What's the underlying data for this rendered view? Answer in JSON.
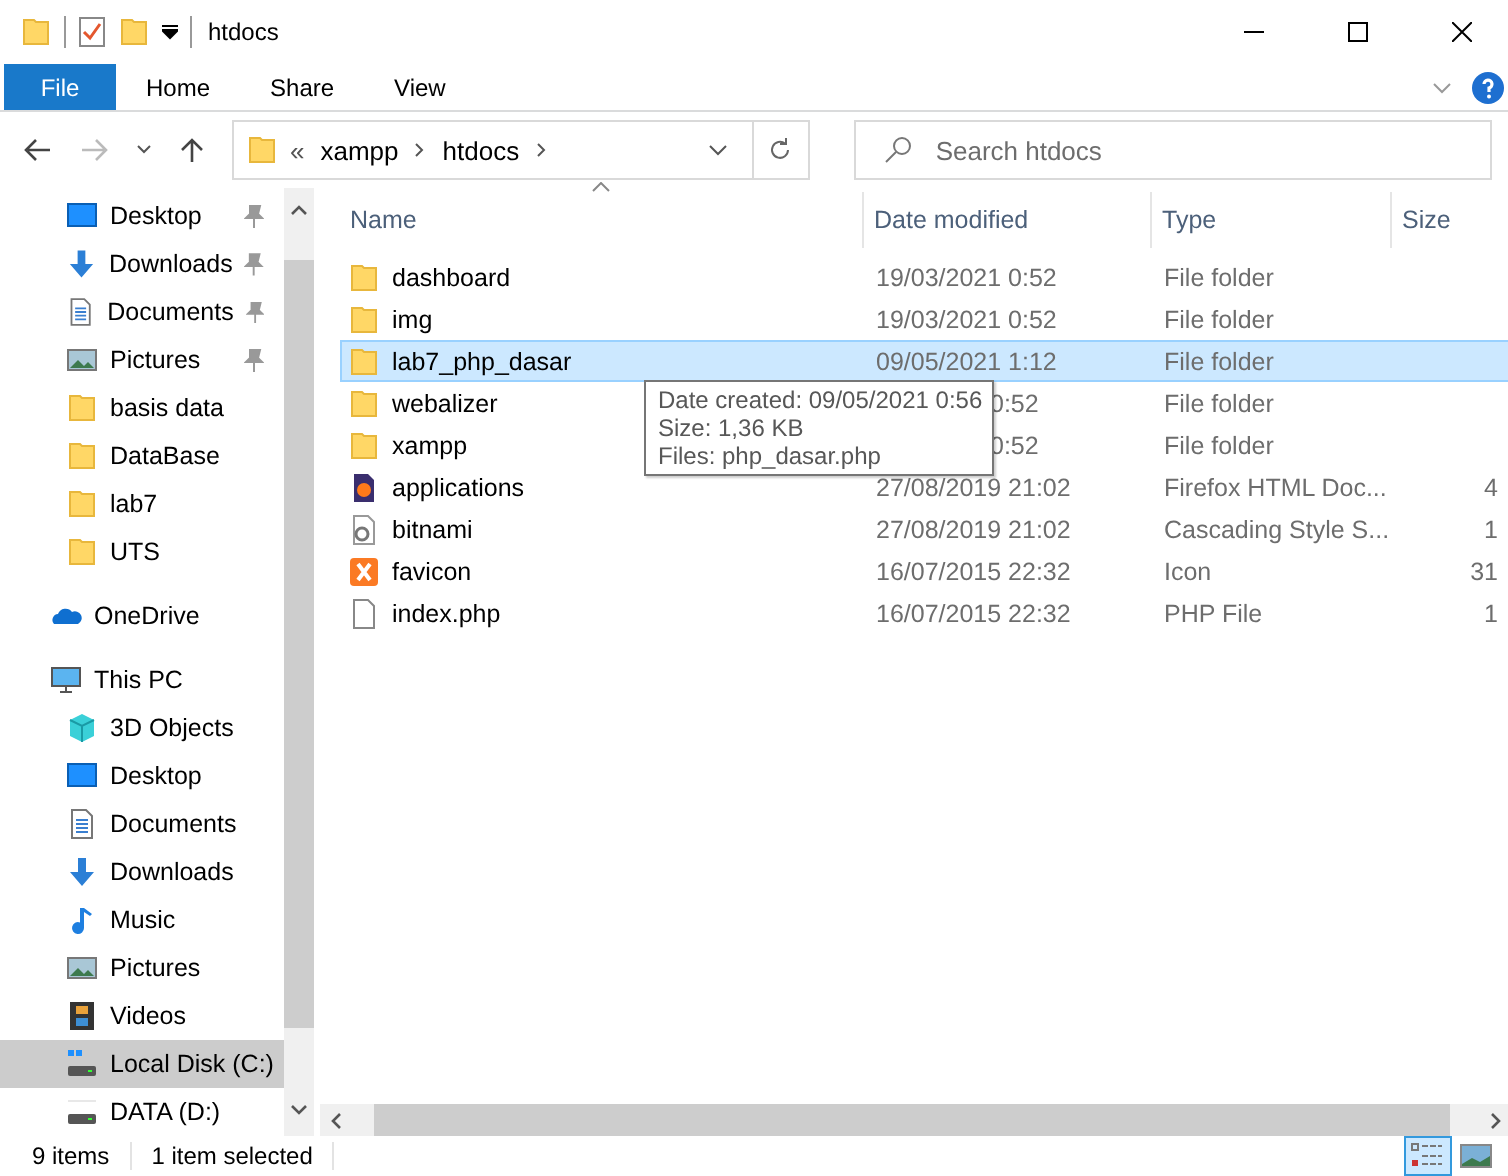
{
  "window": {
    "title": "htdocs"
  },
  "ribbon": {
    "file_button": "File",
    "tabs": [
      {
        "label": "Home"
      },
      {
        "label": "Share"
      },
      {
        "label": "View"
      }
    ]
  },
  "address": {
    "overflow": "«",
    "path": [
      "xampp",
      "htdocs"
    ]
  },
  "search": {
    "placeholder": "Search htdocs"
  },
  "quick_access": [
    {
      "label": "Desktop",
      "kind": "desktop",
      "pinned": true,
      "selected": false
    },
    {
      "label": "Downloads",
      "kind": "downloads",
      "pinned": true,
      "selected": false
    },
    {
      "label": "Documents",
      "kind": "documents",
      "pinned": true,
      "selected": false
    },
    {
      "label": "Pictures",
      "kind": "pictures",
      "pinned": true,
      "selected": false
    },
    {
      "label": "basis data",
      "kind": "folder",
      "pinned": false,
      "selected": false
    },
    {
      "label": "DataBase",
      "kind": "folder",
      "pinned": false,
      "selected": false
    },
    {
      "label": "lab7",
      "kind": "folder",
      "pinned": false,
      "selected": false
    },
    {
      "label": "UTS",
      "kind": "folder",
      "pinned": false,
      "selected": false
    }
  ],
  "nav": [
    {
      "label": "OneDrive",
      "kind": "onedrive",
      "selected": false
    },
    {
      "label": "This PC",
      "kind": "pc",
      "selected": false,
      "children": [
        {
          "label": "3D Objects",
          "kind": "objects3d",
          "selected": false
        },
        {
          "label": "Desktop",
          "kind": "desktop",
          "selected": false
        },
        {
          "label": "Documents",
          "kind": "documents",
          "selected": false
        },
        {
          "label": "Downloads",
          "kind": "downloads",
          "selected": false
        },
        {
          "label": "Music",
          "kind": "music",
          "selected": false
        },
        {
          "label": "Pictures",
          "kind": "pictures",
          "selected": false
        },
        {
          "label": "Videos",
          "kind": "videos",
          "selected": false
        },
        {
          "label": "Local Disk (C:)",
          "kind": "disk-c",
          "selected": true
        },
        {
          "label": "DATA (D:)",
          "kind": "disk",
          "selected": false
        }
      ]
    }
  ],
  "table": {
    "columns": [
      "Name",
      "Date modified",
      "Type",
      "Size"
    ],
    "rows": [
      {
        "kind": "folder",
        "name": "dashboard",
        "date": "19/03/2021 0:52",
        "type": "File folder",
        "selected": false,
        "covered": false
      },
      {
        "kind": "folder",
        "name": "img",
        "date": "19/03/2021 0:52",
        "type": "File folder",
        "selected": false,
        "covered": false
      },
      {
        "kind": "folder",
        "name": "lab7_php_dasar",
        "date": "09/05/2021 1:12",
        "type": "File folder",
        "selected": true,
        "covered": false
      },
      {
        "kind": "folder",
        "name": "webalizer",
        "date": "0:52",
        "type": "File folder",
        "selected": false,
        "covered": true
      },
      {
        "kind": "folder",
        "name": "xampp",
        "date": "0:52",
        "type": "File folder",
        "selected": false,
        "covered": true
      },
      {
        "kind": "firefox",
        "name": "applications",
        "date": "27/08/2019 21:02",
        "type": "Firefox HTML Doc...",
        "size": "4",
        "selected": false,
        "covered": false
      },
      {
        "kind": "css",
        "name": "bitnami",
        "date": "27/08/2019 21:02",
        "type": "Cascading Style S...",
        "size": "1",
        "selected": false,
        "covered": false
      },
      {
        "kind": "xampp",
        "name": "favicon",
        "date": "16/07/2015 22:32",
        "type": "Icon",
        "size": "31",
        "selected": false,
        "covered": false
      },
      {
        "kind": "file",
        "name": "index.php",
        "date": "16/07/2015 22:32",
        "type": "PHP File",
        "size": "1",
        "selected": false,
        "covered": false
      }
    ]
  },
  "tooltip": {
    "lines": [
      "Date created: 09/05/2021 0:56",
      "Size: 1,36 KB",
      "Files: php_dasar.php"
    ]
  },
  "status_bar": {
    "count": "9 items",
    "selection": "1 item selected"
  },
  "view_buttons": [
    {
      "kind": "details",
      "selected": true
    },
    {
      "kind": "large-icons",
      "selected": false
    }
  ]
}
